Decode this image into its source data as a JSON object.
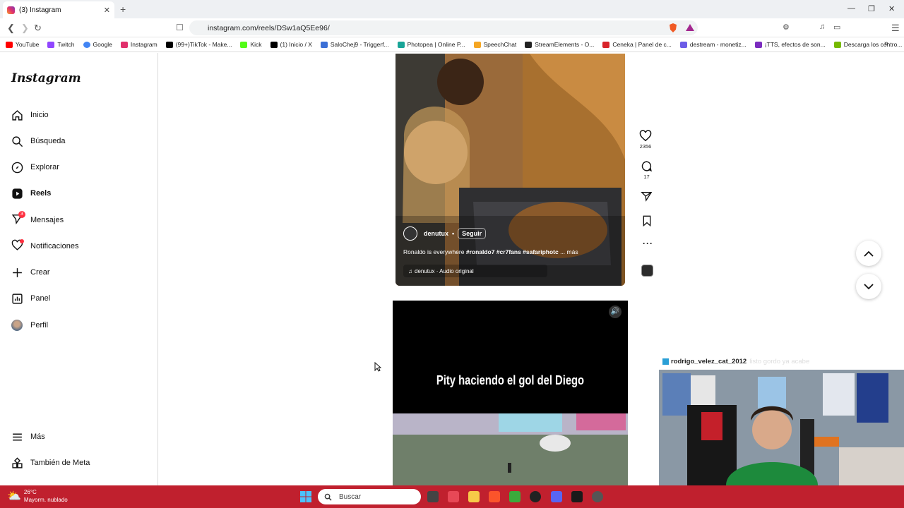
{
  "browser": {
    "tab_title": "(3) Instagram",
    "url": "instagram.com/reels/DSw1aQ5Ee96/",
    "bookmarks": [
      "YouTube",
      "Twitch",
      "Google",
      "Instagram",
      "(99+)TikTok - Make...",
      "Kick",
      "(1) Inicio / X",
      "SaloChej9 - Triggerf...",
      "Photopea | Online P...",
      "SpeechChat",
      "StreamElements - O...",
      "Ceneka | Panel de c...",
      "destream - monetiz...",
      "¡TTS, efectos de son...",
      "Descarga los contro..."
    ]
  },
  "sidebar": {
    "logo": "Instagram",
    "items": [
      {
        "label": "Inicio",
        "icon": "home-icon"
      },
      {
        "label": "Búsqueda",
        "icon": "search-icon"
      },
      {
        "label": "Explorar",
        "icon": "compass-icon"
      },
      {
        "label": "Reels",
        "icon": "reels-icon"
      },
      {
        "label": "Mensajes",
        "icon": "messenger-icon",
        "badge": "3"
      },
      {
        "label": "Notificaciones",
        "icon": "heart-icon"
      },
      {
        "label": "Crear",
        "icon": "plus-icon"
      },
      {
        "label": "Panel",
        "icon": "dashboard-icon"
      },
      {
        "label": "Perfil",
        "icon": "avatar-icon"
      }
    ],
    "more_label": "Más",
    "meta_label": "También de Meta"
  },
  "reel1": {
    "username": "denutux",
    "follow_label": "Seguir",
    "caption": "Ronaldo is everywhere",
    "hashtags": "#ronaldo7 #cr7fans #safariphotc",
    "more": "... más",
    "audio": "denutux · Audio original",
    "likes": "2356",
    "comments": "17"
  },
  "reel2": {
    "title": "Pity haciendo el gol del Diego"
  },
  "stream": {
    "chat_user": "rodrigo_velez_cat_2012",
    "chat_message": "listo gordo ya acabe"
  },
  "taskbar": {
    "temperature": "26°C",
    "weather": "Mayorm. nublado",
    "search_placeholder": "Buscar"
  }
}
